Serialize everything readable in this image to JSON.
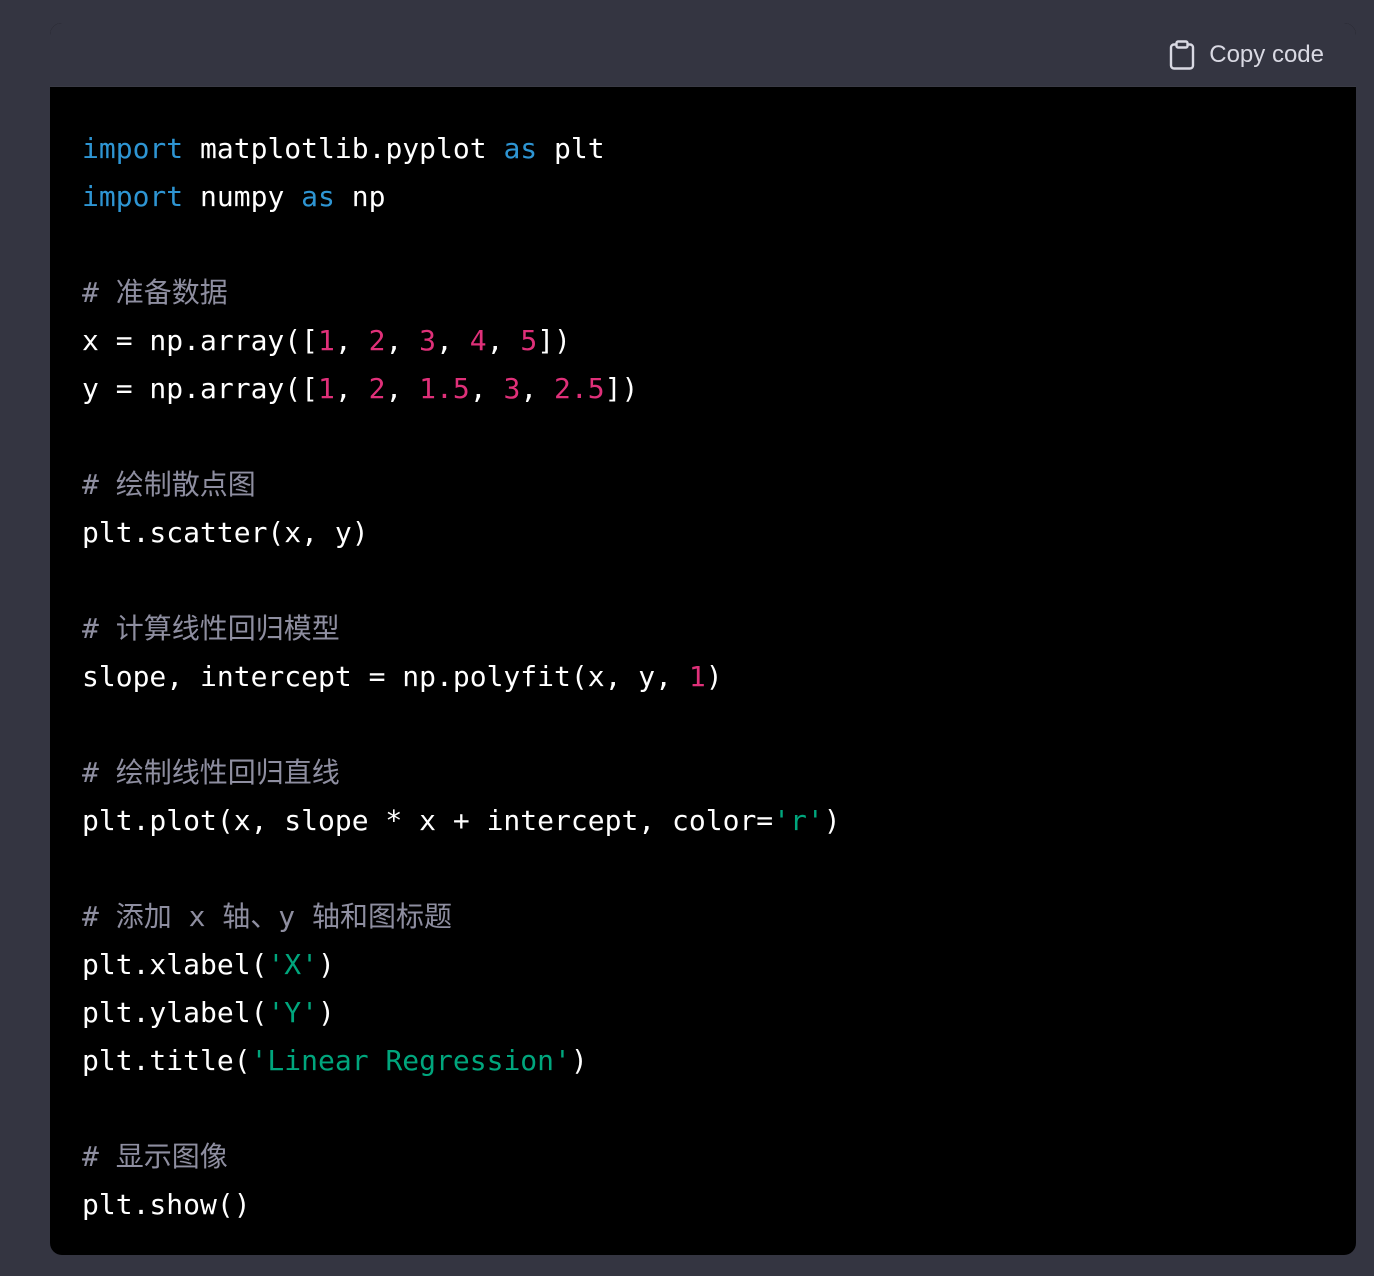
{
  "header": {
    "copy_label": "Copy code",
    "copy_icon": "clipboard-icon"
  },
  "colors": {
    "page_bg": "#343541",
    "code_bg": "#000000",
    "keyword": "#2e95d3",
    "number": "#df3079",
    "string": "#00a67d",
    "comment": "#8e8ea0",
    "text": "#ffffff"
  },
  "code": {
    "language": "python",
    "lines": [
      [
        {
          "t": "kw",
          "v": "import"
        },
        {
          "t": "p",
          "v": " matplotlib.pyplot "
        },
        {
          "t": "kw",
          "v": "as"
        },
        {
          "t": "p",
          "v": " plt"
        }
      ],
      [
        {
          "t": "kw",
          "v": "import"
        },
        {
          "t": "p",
          "v": " numpy "
        },
        {
          "t": "kw",
          "v": "as"
        },
        {
          "t": "p",
          "v": " np"
        }
      ],
      [],
      [
        {
          "t": "cm",
          "v": "# 准备数据"
        }
      ],
      [
        {
          "t": "p",
          "v": "x = np.array(["
        },
        {
          "t": "num",
          "v": "1"
        },
        {
          "t": "p",
          "v": ", "
        },
        {
          "t": "num",
          "v": "2"
        },
        {
          "t": "p",
          "v": ", "
        },
        {
          "t": "num",
          "v": "3"
        },
        {
          "t": "p",
          "v": ", "
        },
        {
          "t": "num",
          "v": "4"
        },
        {
          "t": "p",
          "v": ", "
        },
        {
          "t": "num",
          "v": "5"
        },
        {
          "t": "p",
          "v": "])"
        }
      ],
      [
        {
          "t": "p",
          "v": "y = np.array(["
        },
        {
          "t": "num",
          "v": "1"
        },
        {
          "t": "p",
          "v": ", "
        },
        {
          "t": "num",
          "v": "2"
        },
        {
          "t": "p",
          "v": ", "
        },
        {
          "t": "num",
          "v": "1.5"
        },
        {
          "t": "p",
          "v": ", "
        },
        {
          "t": "num",
          "v": "3"
        },
        {
          "t": "p",
          "v": ", "
        },
        {
          "t": "num",
          "v": "2.5"
        },
        {
          "t": "p",
          "v": "])"
        }
      ],
      [],
      [
        {
          "t": "cm",
          "v": "# 绘制散点图"
        }
      ],
      [
        {
          "t": "p",
          "v": "plt.scatter(x, y)"
        }
      ],
      [],
      [
        {
          "t": "cm",
          "v": "# 计算线性回归模型"
        }
      ],
      [
        {
          "t": "p",
          "v": "slope, intercept = np.polyfit(x, y, "
        },
        {
          "t": "num",
          "v": "1"
        },
        {
          "t": "p",
          "v": ")"
        }
      ],
      [],
      [
        {
          "t": "cm",
          "v": "# 绘制线性回归直线"
        }
      ],
      [
        {
          "t": "p",
          "v": "plt.plot(x, slope * x + intercept, color="
        },
        {
          "t": "str",
          "v": "'r'"
        },
        {
          "t": "p",
          "v": ")"
        }
      ],
      [],
      [
        {
          "t": "cm",
          "v": "# 添加 x 轴、y 轴和图标题"
        }
      ],
      [
        {
          "t": "p",
          "v": "plt.xlabel("
        },
        {
          "t": "str",
          "v": "'X'"
        },
        {
          "t": "p",
          "v": ")"
        }
      ],
      [
        {
          "t": "p",
          "v": "plt.ylabel("
        },
        {
          "t": "str",
          "v": "'Y'"
        },
        {
          "t": "p",
          "v": ")"
        }
      ],
      [
        {
          "t": "p",
          "v": "plt.title("
        },
        {
          "t": "str",
          "v": "'Linear Regression'"
        },
        {
          "t": "p",
          "v": ")"
        }
      ],
      [],
      [
        {
          "t": "cm",
          "v": "# 显示图像"
        }
      ],
      [
        {
          "t": "p",
          "v": "plt.show()"
        }
      ]
    ]
  }
}
